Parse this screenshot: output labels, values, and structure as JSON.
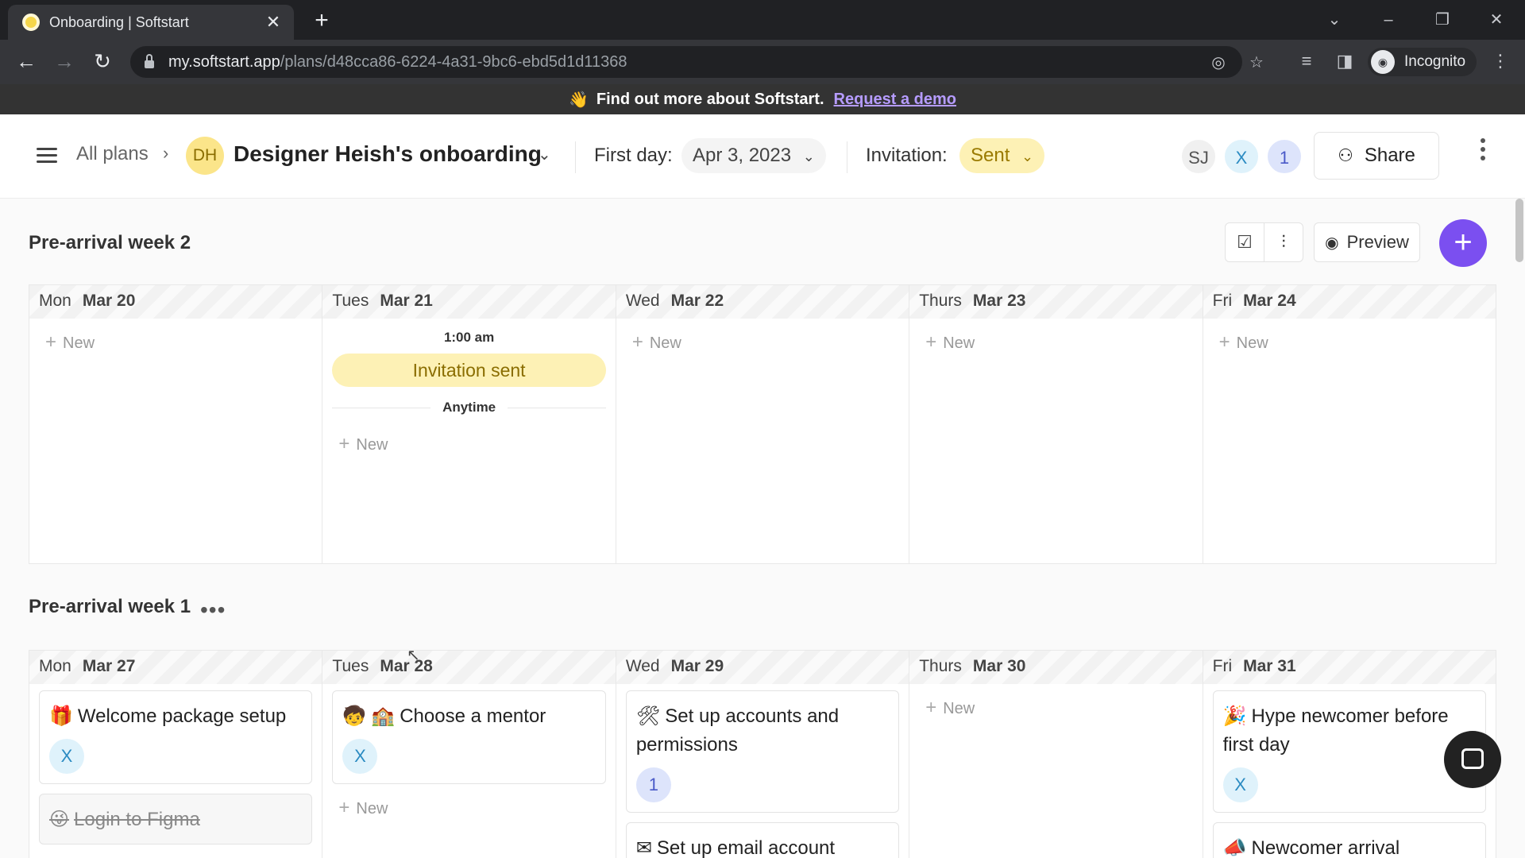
{
  "browser": {
    "tab_title": "Onboarding | Softstart",
    "url_host": "my.softstart.app",
    "url_path": "/plans/d48cca86-6224-4a31-9bc6-ebd5d1d11368",
    "profile_label": "Incognito"
  },
  "banner": {
    "text": "Find out more about Softstart.",
    "link": "Request a demo"
  },
  "header": {
    "breadcrumb_root": "All plans",
    "plan_initials": "DH",
    "plan_title": "Designer Heish's onboarding",
    "first_day_label": "First day:",
    "first_day_value": "Apr 3, 2023",
    "invitation_label": "Invitation:",
    "invitation_value": "Sent",
    "collaborators": [
      "SJ",
      "X",
      "1"
    ],
    "share_label": "Share"
  },
  "toolbar": {
    "preview_label": "Preview"
  },
  "weeks": [
    {
      "title": "Pre-arrival week 2",
      "days": [
        {
          "name": "Mon",
          "date": "Mar 20",
          "new": "New"
        },
        {
          "name": "Tues",
          "date": "Mar 21",
          "time1": "1:00 am",
          "event": "Invitation sent",
          "time2": "Anytime",
          "new": "New"
        },
        {
          "name": "Wed",
          "date": "Mar 22",
          "new": "New"
        },
        {
          "name": "Thurs",
          "date": "Mar 23",
          "new": "New"
        },
        {
          "name": "Fri",
          "date": "Mar 24",
          "new": "New"
        }
      ]
    },
    {
      "title": "Pre-arrival week 1",
      "days": [
        {
          "name": "Mon",
          "date": "Mar 27",
          "task1": "Welcome package setup",
          "task1_assignee": "X",
          "task2": "Login to Figma"
        },
        {
          "name": "Tues",
          "date": "Mar 28",
          "task1": "Choose a mentor",
          "task1_assignee": "X",
          "new": "New"
        },
        {
          "name": "Wed",
          "date": "Mar 29",
          "task1": "Set up accounts and permissions",
          "task1_assignee": "1",
          "task2": "Set up email account"
        },
        {
          "name": "Thurs",
          "date": "Mar 30",
          "new": "New"
        },
        {
          "name": "Fri",
          "date": "Mar 31",
          "task1": "Hype newcomer before first day",
          "task1_assignee": "X",
          "task2": "Newcomer arrival"
        }
      ]
    }
  ]
}
